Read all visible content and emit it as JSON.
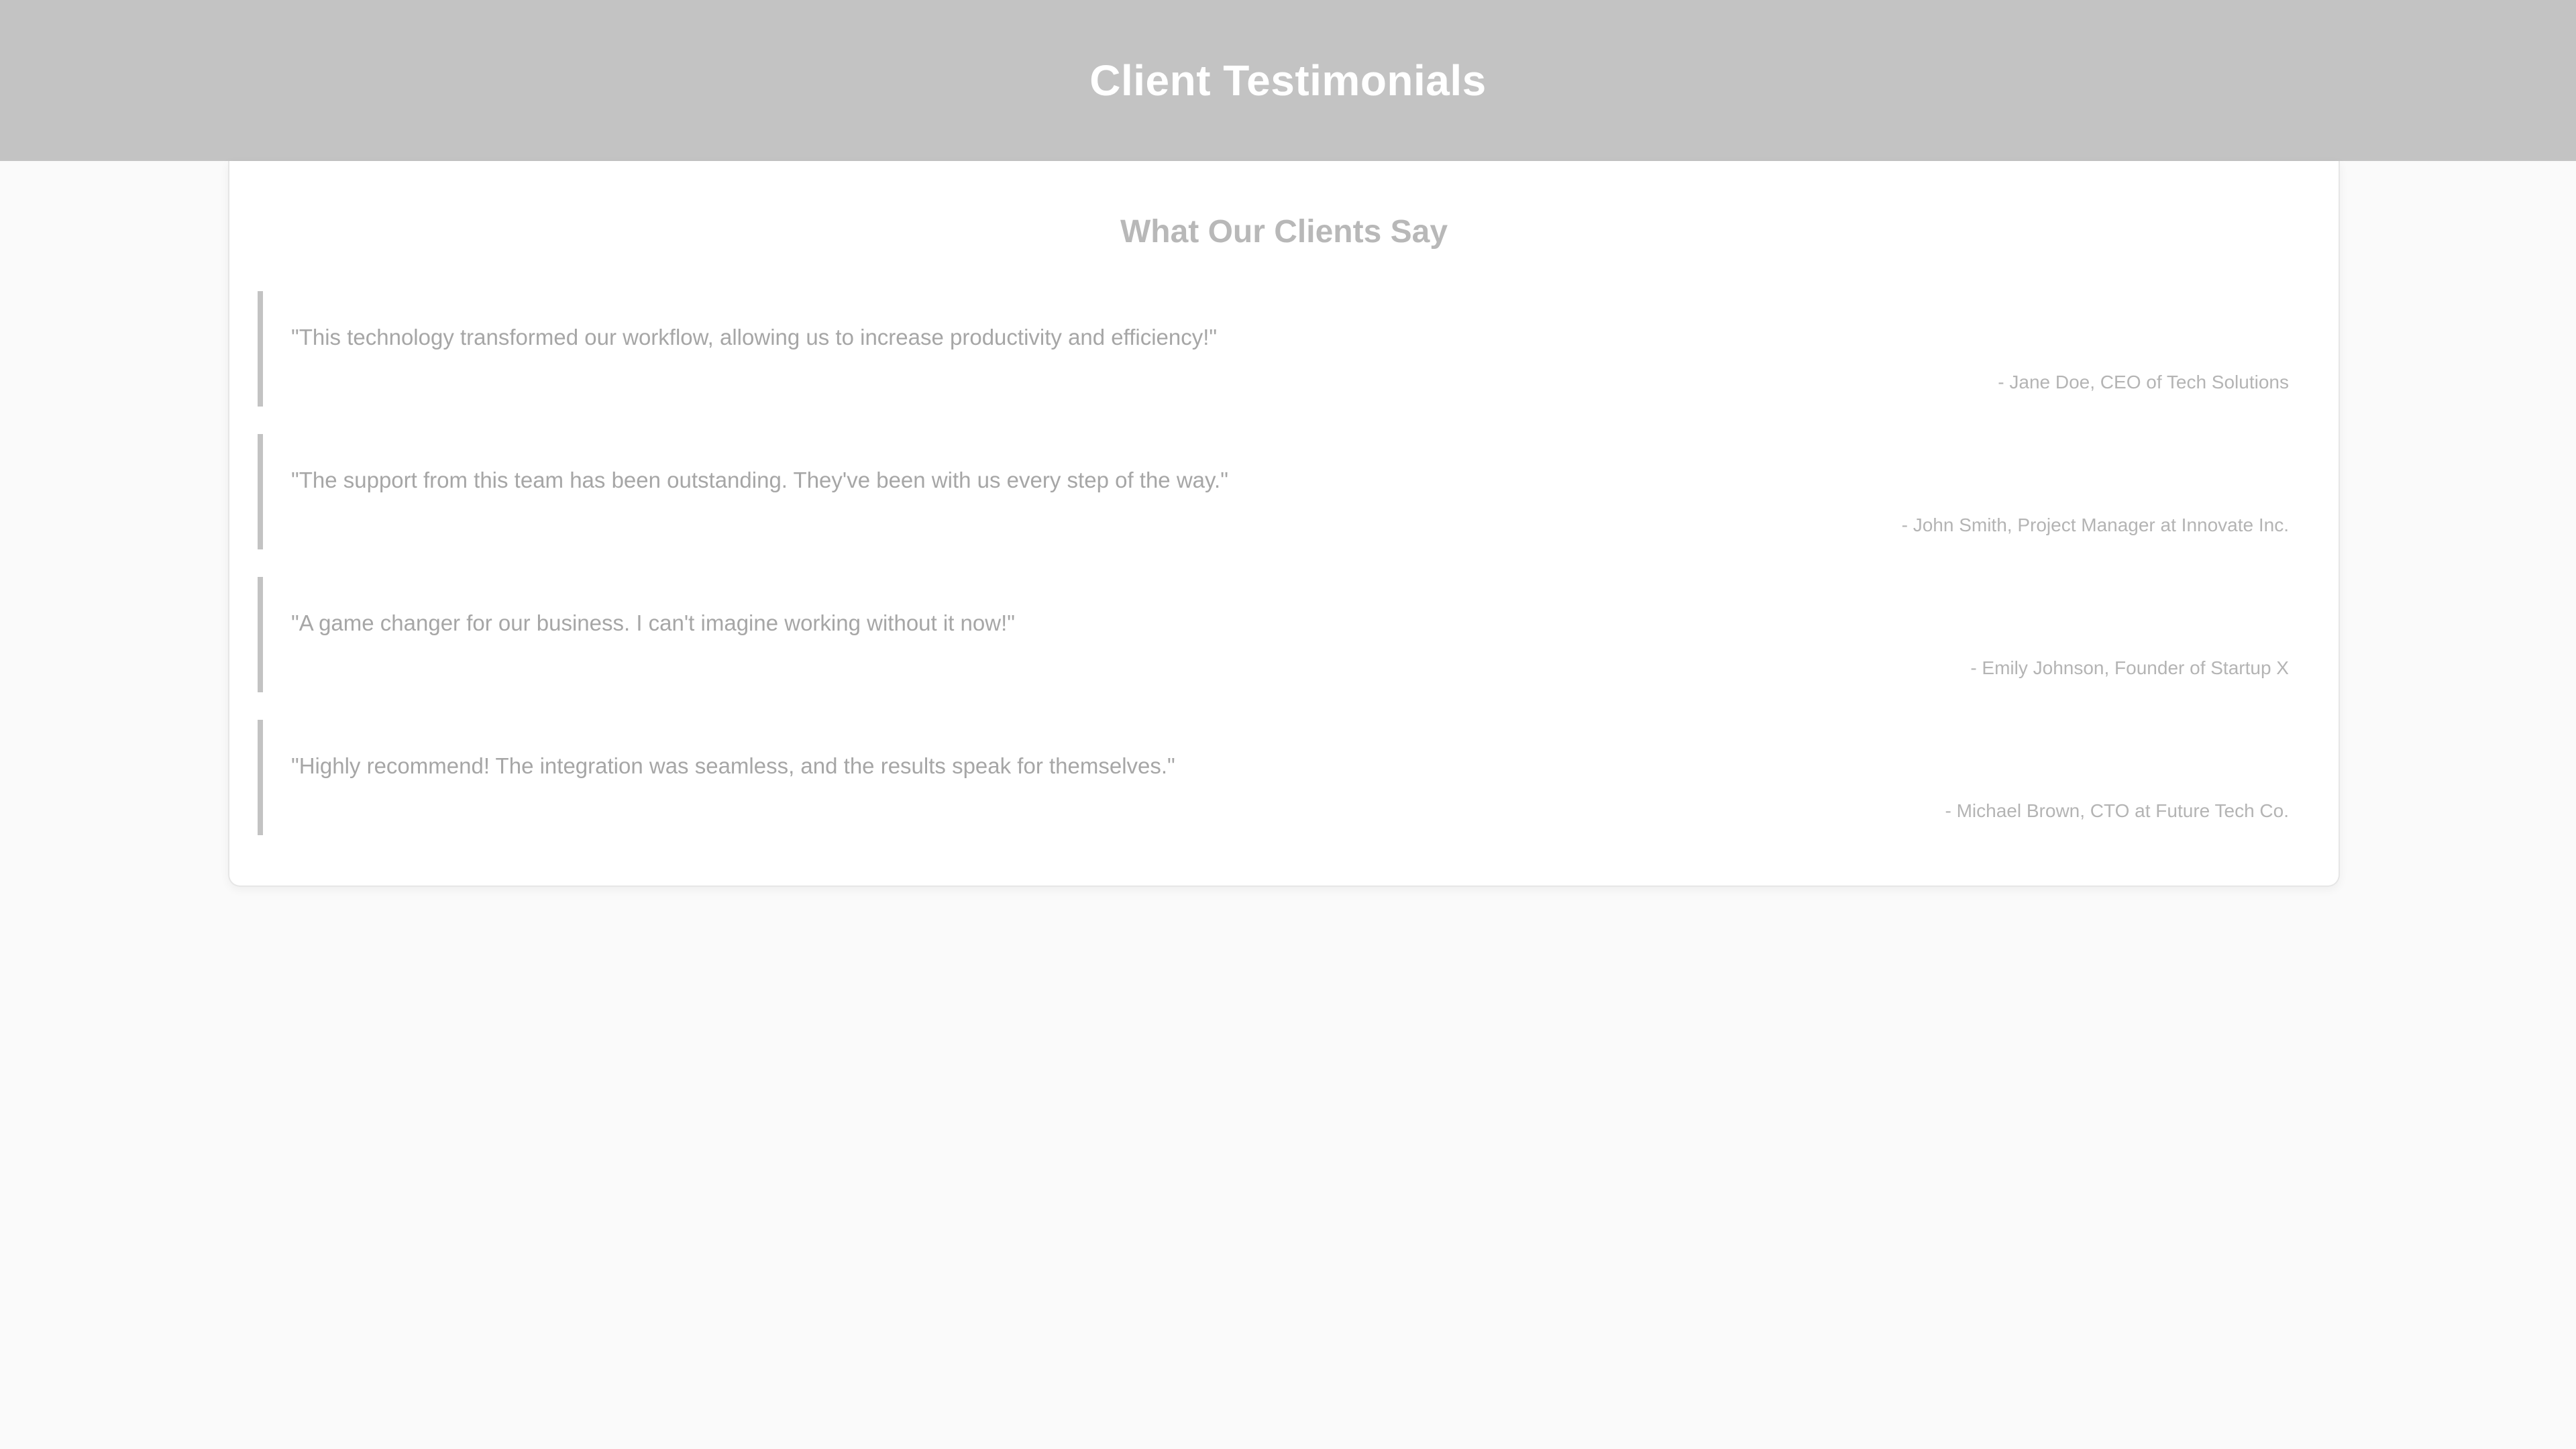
{
  "header": {
    "title": "Client Testimonials"
  },
  "main": {
    "section_title": "What Our Clients Say",
    "testimonials": [
      {
        "quote": "\"This technology transformed our workflow, allowing us to increase productivity and efficiency!\"",
        "author": "- Jane Doe, CEO of Tech Solutions"
      },
      {
        "quote": "\"The support from this team has been outstanding. They've been with us every step of the way.\"",
        "author": "- John Smith, Project Manager at Innovate Inc."
      },
      {
        "quote": "\"A game changer for our business. I can't imagine working without it now!\"",
        "author": "- Emily Johnson, Founder of Startup X"
      },
      {
        "quote": "\"Highly recommend! The integration was seamless, and the results speak for themselves.\"",
        "author": "- Michael Brown, CTO at Future Tech Co."
      }
    ]
  },
  "colors": {
    "header_bg": "#c3c3c3",
    "page_bg": "#fafafa",
    "card_bg": "#ffffff",
    "accent_border": "#c3c3c3"
  }
}
